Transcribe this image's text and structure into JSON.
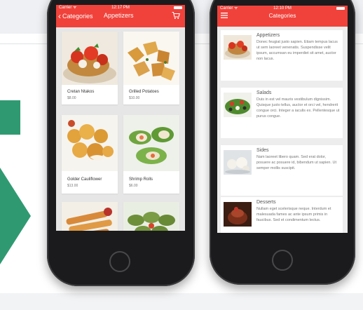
{
  "phone_left": {
    "status": {
      "carrier": "Carrier ᯤ",
      "time": "12:17 PM"
    },
    "nav": {
      "back_label": "Categories",
      "title": "Appetizers"
    },
    "items": [
      {
        "name": "Cretan Ntakos",
        "price": "$8.00"
      },
      {
        "name": "Grilled Potatoes",
        "price": "$10.00"
      },
      {
        "name": "Golder Cauliflower",
        "price": "$13.00"
      },
      {
        "name": "Shrimp Rolls",
        "price": "$6.00"
      },
      {
        "name": "",
        "price": ""
      },
      {
        "name": "",
        "price": ""
      }
    ]
  },
  "phone_right": {
    "status": {
      "carrier": "Carrier ᯤ",
      "time": "12:10 PM"
    },
    "nav": {
      "title": "Categories"
    },
    "categories": [
      {
        "title": "Appetizers",
        "description": "Donec feugiat justo sapien. Etiam tempus lacus ut sem laoreet venenatis. Suspendisse velit ipsum, accumsan eu imperdiet sit amet, auctor non lacus."
      },
      {
        "title": "Salads",
        "description": "Duis in est vel mauris vestibulum dignissim. Quisque justo tellus, auctor et orci vel, hendrerit congue orci. Integer a iaculis ex. Pellentesque ut purus congue."
      },
      {
        "title": "Sides",
        "description": "Nam laoreet libero quam. Sed erat dolor, posuere ac posuere id, bibendum ut sapien. Ut semper mollis suscipit."
      },
      {
        "title": "Desserts",
        "description": "Nullam eget scelerisque neque. Interdum et malesuada fames ac ante ipsum primis in faucibus. Sed et condimentum lectus."
      }
    ]
  },
  "colors": {
    "nav_red": "#f0423b",
    "brand_green": "#2f9a72",
    "phone_black": "#1b1b1d"
  }
}
